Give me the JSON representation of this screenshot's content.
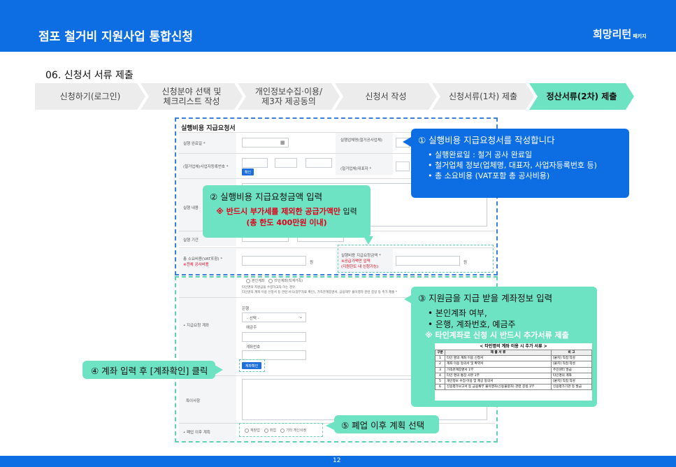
{
  "header": {
    "title": "점포 철거비 지원사업 통합신청",
    "logo": "희망리턴",
    "logo_sub": "패키지"
  },
  "section_title": "06. 신청서 서류 제출",
  "steps": [
    {
      "label": "신청하기(로그인)"
    },
    {
      "label_lines": [
        "신청분야 선택 및",
        "체크리스트 작성"
      ]
    },
    {
      "label_lines": [
        "개인정보수집·이용/",
        "제3자 제공동의"
      ]
    },
    {
      "label": "신청서 작성"
    },
    {
      "label": "신청서류(1차) 제출"
    },
    {
      "label": "정산서류(2차) 제출",
      "active": true
    }
  ],
  "form": {
    "title": "실행비용 지급요청서",
    "rows": {
      "complete_date": "실행 완료일 *",
      "contractor_biz_no": "(철거업체)사업자등록번호 *",
      "confirm_btn": "확인",
      "contractor_name": "실행업체명(철거공사업체)",
      "ceo": "(철거업체)대표자 *",
      "content": "실행 내용",
      "period": "실행 기간",
      "total_cost": "총 소요비용(VAT포함) *",
      "total_cost_note": "※전체 공사비용",
      "request_amount": "실행비용 지급요청금액 *",
      "request_note1": "※공급가액만 입력",
      "request_note2": "(지원한도 내 신청가능)",
      "unit": "원"
    },
    "account": {
      "radio_self": "본인계좌",
      "radio_other": "타인계좌(직계가족)",
      "note1": "타인명의 지원금을 수령하고자 하는 경우",
      "note2": "타인명의 계좌 이용 신청서 등 관련 서식(첨부자료 확인), 가족관계증명서, 금융재무 불이행자 관련 증빙 등 추가 제출 *",
      "label": "• 지급요청 계좌",
      "bank_label": "은행",
      "bank_select": "- 선택 -",
      "holder_label": "예금주",
      "number_label": "계좌번호",
      "check_btn": "계좌확인",
      "special": "특이사항",
      "plan_label": "• 폐업 이후 계획",
      "plan_opts": [
        "재창업",
        "취업",
        "기타 개인사정"
      ]
    }
  },
  "callouts": {
    "c1": {
      "heading": "① 실행비용 지급요청서를 작성합니다",
      "bullets": [
        "실행완료일 : 철거 공사 완료일",
        "철거업체 정보(업체명, 대표자, 사업자등록번호 등)",
        "총 소요비용 (VAT포함 총 공사비용)"
      ]
    },
    "c2": {
      "heading": "② 실행비용 지급요청금액 입력",
      "note_prefix": "※ 반드시 ",
      "note_red": "부가세를 제외한 공급가액만",
      "note_suffix": " 입력",
      "limit": "(총 한도 400만원 이내)"
    },
    "c3": {
      "heading": "③ 지원금을 지급 받을 계좌정보 입력",
      "bullets": [
        "본인계좌 여부,",
        "은행, 계좌번호, 예금주"
      ],
      "note": "※ 타인계좌로 신청 시 반드시 추가서류 제출"
    },
    "c4": {
      "text": "④ 계좌 입력 후 [계좌확인] 클릭"
    },
    "c5": {
      "text": "⑤ 폐업 이후 계획 선택"
    }
  },
  "doc_table": {
    "title": "< 타인명의 계좌 이용 시 추가 서류 >",
    "headers": [
      "구분",
      "제 출 서 류",
      "비 고"
    ],
    "rows": [
      [
        "1",
        "타인 명의 계좌 이용 신청서",
        "[붙지] 직접 작성"
      ],
      [
        "2",
        "계좌 이용 동의서 및 확약서",
        "[붙지] 직접 작성"
      ],
      [
        "3",
        "가족관계증명서 1부",
        "주민센터 발급"
      ],
      [
        "4",
        "타인 명의 통장 사본 1부",
        "타인명의 계좌"
      ],
      [
        "5",
        "개인정보 수집·이용 및 제공 동의서",
        "[붙지] 직접 작성"
      ],
      [
        "6",
        "신용평가보고서 등 금융채무 불이행자(신용불량자) 관련 증빙 1부",
        "신용평가기관 등 발급"
      ]
    ]
  },
  "footer": {
    "page": "12"
  },
  "colors": {
    "primary": "#0d6ee4",
    "mint": "#6de3c4",
    "red": "#e2001a"
  }
}
